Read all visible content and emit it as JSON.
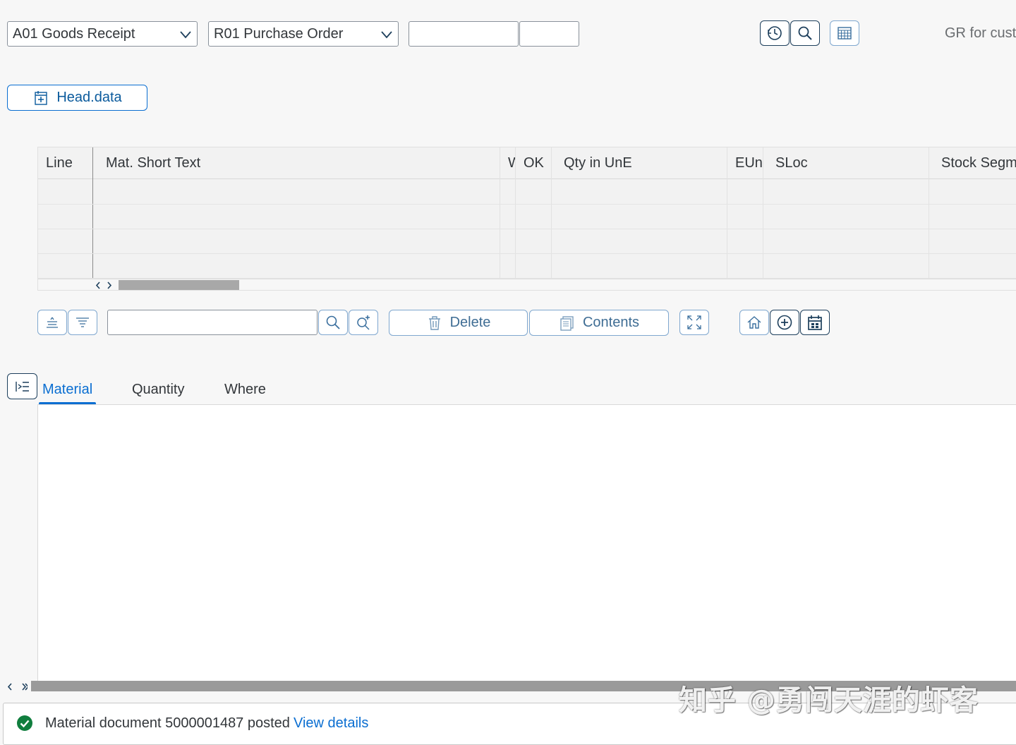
{
  "toolbar": {
    "transaction_select": "A01 Goods Receipt",
    "reference_select": "R01 Purchase Order",
    "reference_number_value": "",
    "reference_item_value": "",
    "right_label": "GR for custo"
  },
  "head_data_button": "Head.data",
  "table": {
    "columns": [
      "Line",
      "Mat. Short Text",
      "W",
      "OK",
      "Qty in UnE",
      "EUn",
      "SLoc",
      "Stock Segme"
    ],
    "rows": [
      [
        "",
        "",
        "",
        "",
        "",
        "",
        "",
        ""
      ],
      [
        "",
        "",
        "",
        "",
        "",
        "",
        "",
        ""
      ],
      [
        "",
        "",
        "",
        "",
        "",
        "",
        "",
        ""
      ],
      [
        "",
        "",
        "",
        "",
        "",
        "",
        "",
        ""
      ]
    ]
  },
  "item_toolbar": {
    "search_value": "",
    "delete_label": "Delete",
    "contents_label": "Contents"
  },
  "tabs": [
    "Material",
    "Quantity",
    "Where"
  ],
  "active_tab": "Material",
  "status": {
    "message": "Material document 5000001487 posted",
    "link": "View details",
    "type": "success"
  },
  "watermark": "知乎 @勇闯天涯的虾客",
  "colors": {
    "accent": "#0a6ed1",
    "success": "#107e3e",
    "background": "#f7f7f7"
  },
  "icons": {
    "history": "clock-history-icon",
    "search": "search-icon",
    "layout": "column-layout-icon",
    "expand": "expand-header-icon",
    "sort_ascending": "sort-ascending-icon",
    "filter": "filter-icon",
    "search_more": "search-more-icon",
    "delete": "trash-icon",
    "contents": "contents-icon",
    "fullscreen": "fullscreen-icon",
    "home": "home-icon",
    "add": "add-icon",
    "calendar": "calendar-icon",
    "collapse": "collapse-detail-icon",
    "success": "checkmark-circle-icon"
  }
}
